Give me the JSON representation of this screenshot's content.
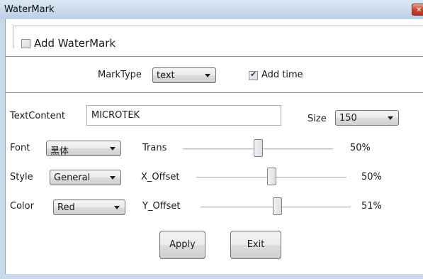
{
  "window": {
    "title": "WaterMark",
    "close_glyph": "✕"
  },
  "add_watermark": {
    "label": "Add WaterMark",
    "checked": false
  },
  "mark_type": {
    "label": "MarkType",
    "value": "text"
  },
  "add_time": {
    "label": "Add time",
    "checked": true
  },
  "text_content": {
    "label": "TextContent",
    "value": "MICROTEK"
  },
  "size": {
    "label": "Size",
    "value": "150"
  },
  "font": {
    "label": "Font",
    "value": "黑体"
  },
  "style": {
    "label": "Style",
    "value": "General"
  },
  "color": {
    "label": "Color",
    "value": "Red"
  },
  "trans": {
    "label": "Trans",
    "value_text": "50%",
    "value": 0.5
  },
  "x_offset": {
    "label": "X_Offset",
    "value_text": "50%",
    "value": 0.5
  },
  "y_offset": {
    "label": "Y_Offset",
    "value_text": "51%",
    "value": 0.51
  },
  "buttons": {
    "apply": "Apply",
    "exit": "Exit"
  }
}
